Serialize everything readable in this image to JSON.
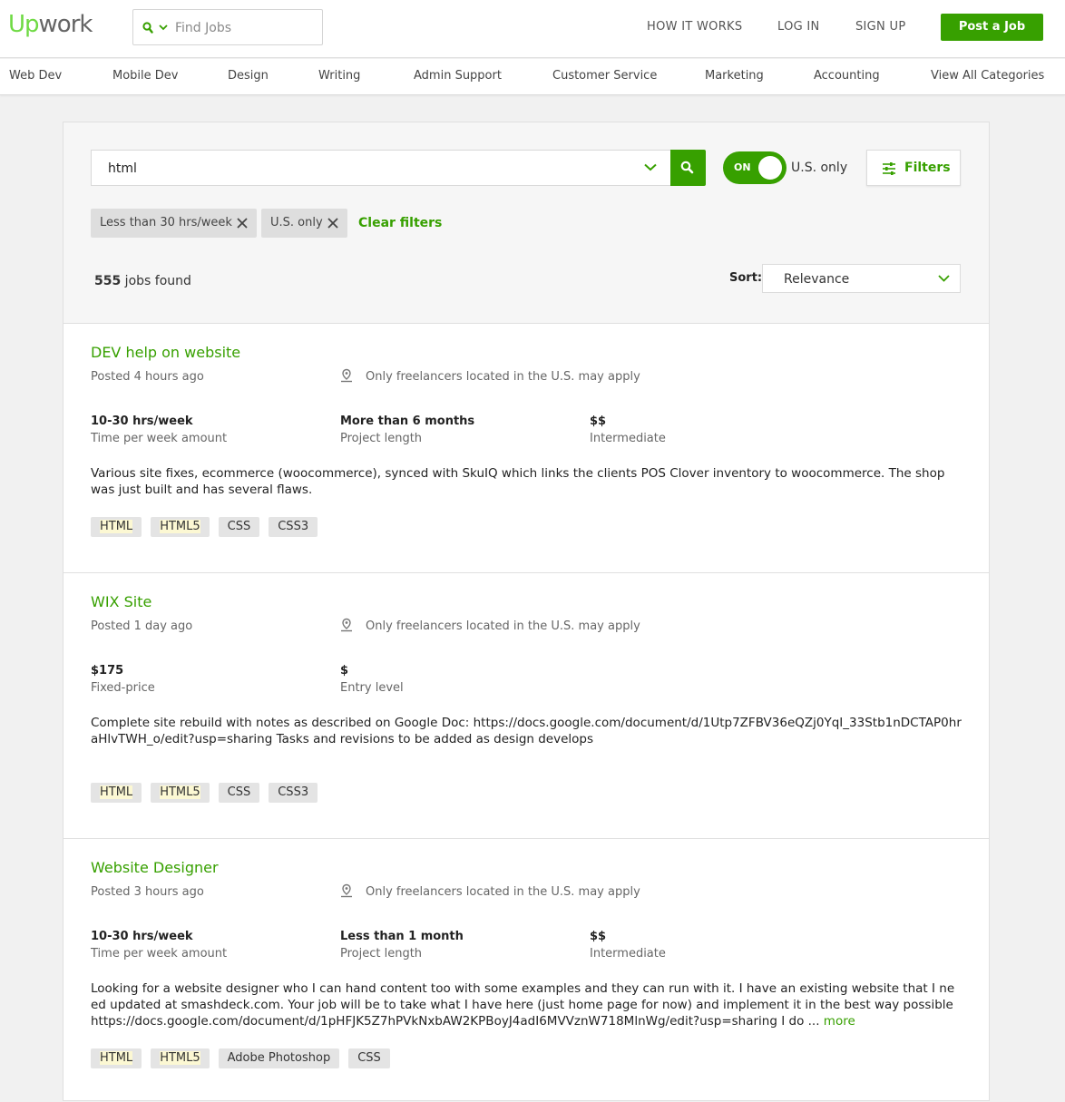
{
  "header": {
    "logo": {
      "up": "Up",
      "work": "work"
    },
    "find_jobs_placeholder": "Find Jobs",
    "nav": [
      "HOW IT WORKS",
      "LOG IN",
      "SIGN UP"
    ],
    "post_job": "Post a Job"
  },
  "categories": [
    "Web Dev",
    "Mobile Dev",
    "Design",
    "Writing",
    "Admin Support",
    "Customer Service",
    "Marketing",
    "Accounting",
    "View All Categories"
  ],
  "search": {
    "query": "html",
    "toggle_state": "ON",
    "us_only_label": "U.S. only",
    "filters_label": "Filters"
  },
  "active_filters": [
    "Less than 30 hrs/week",
    "U.S. only"
  ],
  "clear_filters": "Clear filters",
  "results": {
    "count": "555",
    "label": " jobs found"
  },
  "sort": {
    "label": "Sort:",
    "value": "Relevance"
  },
  "jobs": [
    {
      "title": "DEV help on website",
      "posted": "Posted 4 hours ago",
      "location": "Only freelancers located in the U.S. may apply",
      "stats": [
        {
          "value": "10-30 hrs/week",
          "label": "Time per week amount"
        },
        {
          "value": "More than 6 months",
          "label": "Project length"
        },
        {
          "value": "$$",
          "label": "Intermediate"
        }
      ],
      "description": "Various site fixes, ecommerce (woocommerce), synced with SkuIQ which links the clients POS Clover inventory to woocommerce. The shop was just built and has several flaws.",
      "more": "",
      "tags": [
        "HTML",
        "HTML5",
        "CSS",
        "CSS3"
      ]
    },
    {
      "title": "WIX Site",
      "posted": "Posted 1 day ago",
      "location": "Only freelancers located in the U.S. may apply",
      "stats": [
        {
          "value": "$175",
          "label": "Fixed-price"
        },
        {
          "value": "$",
          "label": "Entry level"
        }
      ],
      "description": "Complete site rebuild with notes as described on Google Doc: https://docs.google.com/document/d/1Utp7ZFBV36eQZj0YqI_33Stb1nDCTAP0hraHlvTWH_o/edit?usp=sharing Tasks and revisions to be added as design develops",
      "more": "",
      "tags": [
        "HTML",
        "HTML5",
        "CSS",
        "CSS3"
      ]
    },
    {
      "title": "Website Designer",
      "posted": "Posted 3 hours ago",
      "location": "Only freelancers located in the U.S. may apply",
      "stats": [
        {
          "value": "10-30 hrs/week",
          "label": "Time per week amount"
        },
        {
          "value": "Less than 1 month",
          "label": "Project length"
        },
        {
          "value": "$$",
          "label": "Intermediate"
        }
      ],
      "description": "Looking for a website designer who I can hand content too with some examples and they can run with it. I have an existing website that I need updated at smashdeck.com. Your job will be to take what I have here (just home page for now) and implement it in the best way possible https://docs.google.com/document/d/1pHFJK5Z7hPVkNxbAW2KPBoyJ4adI6MVVznW718MlnWg/edit?usp=sharing I do ...",
      "more": "more",
      "tags": [
        "HTML",
        "HTML5",
        "Adobe Photoshop",
        "CSS"
      ]
    }
  ],
  "colors": {
    "accent": "#37a000",
    "logo_green": "#6fda44",
    "highlight": "#fcf8d3"
  }
}
